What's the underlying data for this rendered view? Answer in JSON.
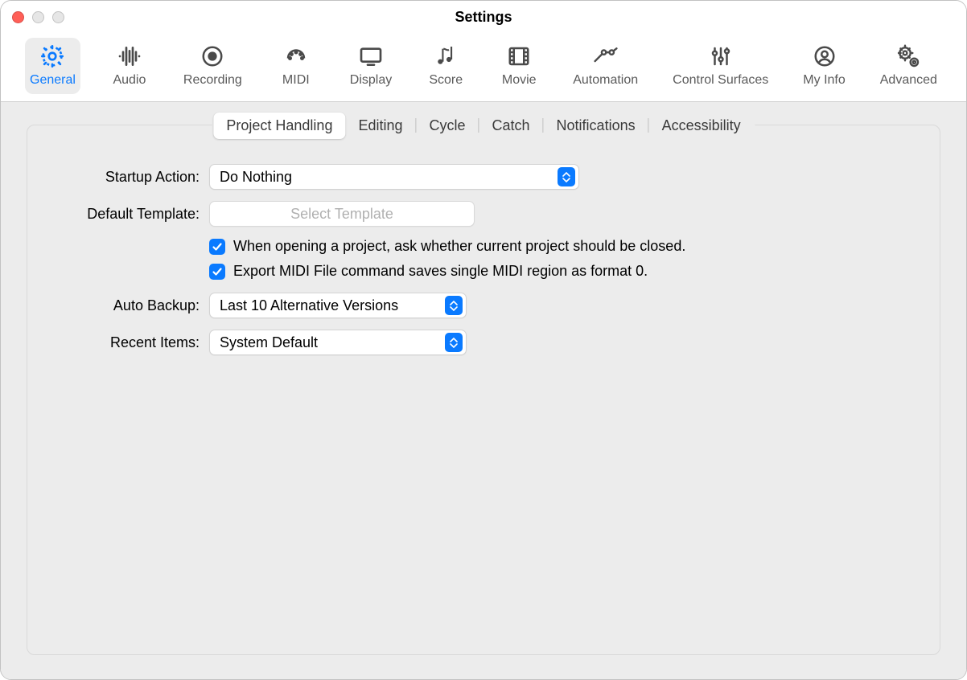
{
  "window": {
    "title": "Settings"
  },
  "toolbar": {
    "items": [
      {
        "label": "General"
      },
      {
        "label": "Audio"
      },
      {
        "label": "Recording"
      },
      {
        "label": "MIDI"
      },
      {
        "label": "Display"
      },
      {
        "label": "Score"
      },
      {
        "label": "Movie"
      },
      {
        "label": "Automation"
      },
      {
        "label": "Control Surfaces"
      },
      {
        "label": "My Info"
      },
      {
        "label": "Advanced"
      }
    ]
  },
  "tabs": {
    "items": [
      {
        "label": "Project Handling"
      },
      {
        "label": "Editing"
      },
      {
        "label": "Cycle"
      },
      {
        "label": "Catch"
      },
      {
        "label": "Notifications"
      },
      {
        "label": "Accessibility"
      }
    ]
  },
  "form": {
    "startup_label": "Startup Action:",
    "startup_value": "Do Nothing",
    "template_label": "Default Template:",
    "template_button": "Select Template",
    "check1": "When opening a project, ask whether current project should be closed.",
    "check2": "Export MIDI File command saves single MIDI region as format 0.",
    "backup_label": "Auto Backup:",
    "backup_value": "Last 10 Alternative Versions",
    "recent_label": "Recent Items:",
    "recent_value": "System Default"
  }
}
